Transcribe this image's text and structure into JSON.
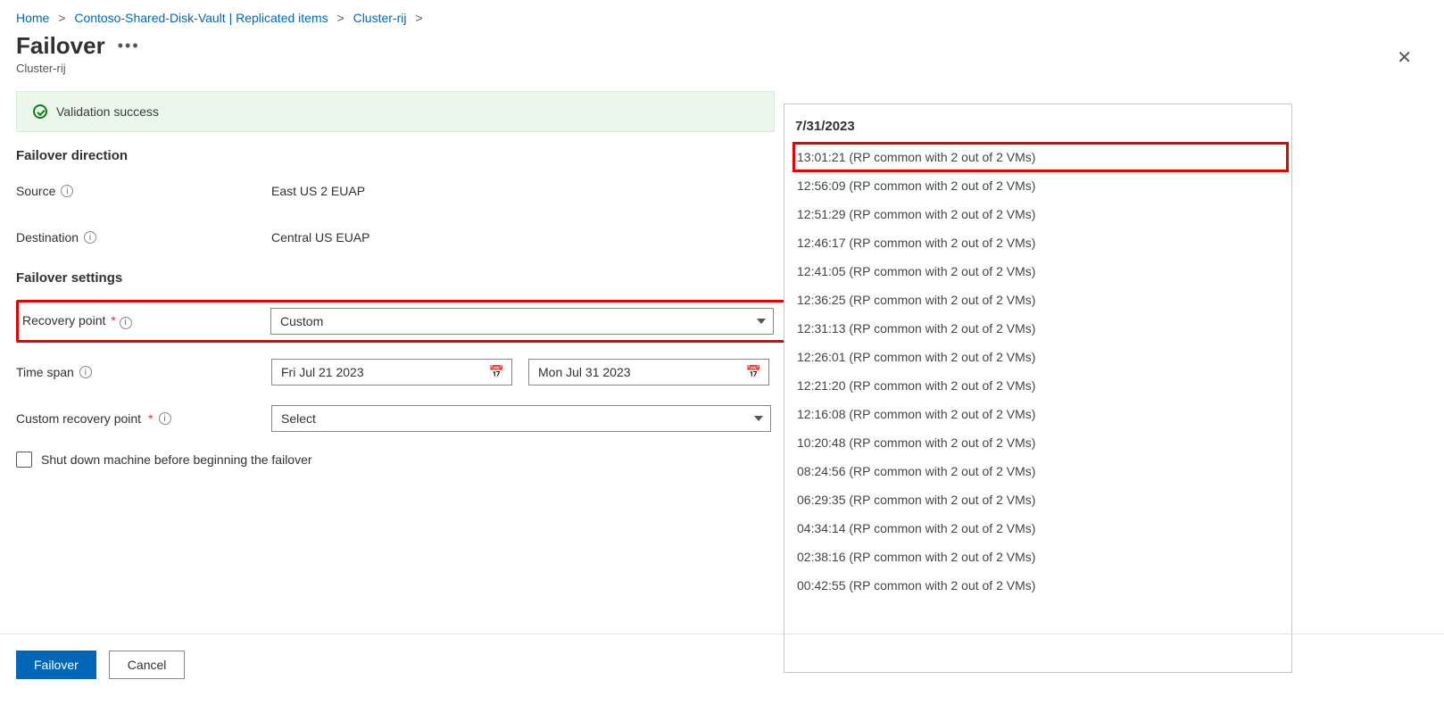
{
  "breadcrumb": {
    "items": [
      "Home",
      "Contoso-Shared-Disk-Vault | Replicated items",
      "Cluster-rij"
    ]
  },
  "header": {
    "title": "Failover",
    "subtitle": "Cluster-rij"
  },
  "banner": {
    "text": "Validation success"
  },
  "sections": {
    "direction_heading": "Failover direction",
    "settings_heading": "Failover settings"
  },
  "fields": {
    "source_label": "Source",
    "source_value": "East US 2 EUAP",
    "destination_label": "Destination",
    "destination_value": "Central US EUAP",
    "recovery_point_label": "Recovery point",
    "recovery_point_value": "Custom",
    "time_span_label": "Time span",
    "time_span_from": "Fri Jul 21 2023",
    "time_span_to": "Mon Jul 31 2023",
    "custom_rp_label": "Custom recovery point",
    "custom_rp_value": "Select",
    "shutdown_label": "Shut down machine before beginning the failover"
  },
  "footer": {
    "primary": "Failover",
    "secondary": "Cancel"
  },
  "rp_list": {
    "date": "7/31/2023",
    "items": [
      "13:01:21 (RP common with 2 out of 2 VMs)",
      "12:56:09 (RP common with 2 out of 2 VMs)",
      "12:51:29 (RP common with 2 out of 2 VMs)",
      "12:46:17 (RP common with 2 out of 2 VMs)",
      "12:41:05 (RP common with 2 out of 2 VMs)",
      "12:36:25 (RP common with 2 out of 2 VMs)",
      "12:31:13 (RP common with 2 out of 2 VMs)",
      "12:26:01 (RP common with 2 out of 2 VMs)",
      "12:21:20 (RP common with 2 out of 2 VMs)",
      "12:16:08 (RP common with 2 out of 2 VMs)",
      "10:20:48 (RP common with 2 out of 2 VMs)",
      "08:24:56 (RP common with 2 out of 2 VMs)",
      "06:29:35 (RP common with 2 out of 2 VMs)",
      "04:34:14 (RP common with 2 out of 2 VMs)",
      "02:38:16 (RP common with 2 out of 2 VMs)",
      "00:42:55 (RP common with 2 out of 2 VMs)"
    ],
    "highlight_index": 0
  }
}
